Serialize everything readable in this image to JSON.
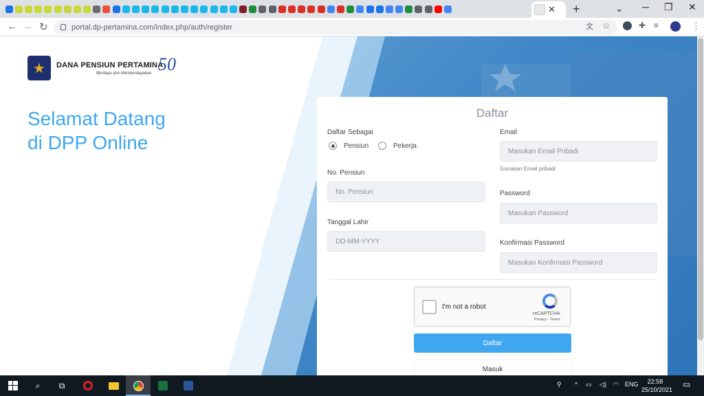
{
  "browser": {
    "url": "portal.dp-pertamina.com/index.php/auth/register",
    "tab_close": "✕",
    "new_tab": "+",
    "win_min": "─",
    "win_max": "❐",
    "win_close": "✕",
    "tab_icon_colors": [
      "#1a73e8",
      "#c8d93a",
      "#c8d93a",
      "#c8d93a",
      "#c8d93a",
      "#c8d93a",
      "#c8d93a",
      "#c8d93a",
      "#c8d93a",
      "#6b6b6b",
      "#e74c3c",
      "#1a73e8",
      "#1ab7ea",
      "#1ab7ea",
      "#1ab7ea",
      "#1ab7ea",
      "#1ab7ea",
      "#1ab7ea",
      "#1ab7ea",
      "#1ab7ea",
      "#1ab7ea",
      "#1ab7ea",
      "#1ab7ea",
      "#1ab7ea",
      "#7a1f2b",
      "#1e8e3e",
      "#5f6368",
      "#5f6368",
      "#d93025",
      "#d93025",
      "#d93025",
      "#d93025",
      "#d93025",
      "#4285f4",
      "#d93025",
      "#1e8e3e",
      "#4285f4",
      "#1a73e8",
      "#1a73e8",
      "#4285f4",
      "#4285f4",
      "#1e8e3e",
      "#5f6368",
      "#5f6368",
      "#ff0000",
      "#4285f4"
    ]
  },
  "page": {
    "logo_title": "DANA PENSIUN PERTAMINA",
    "logo_tagline": "Berdaya dan Memberdayakan",
    "logo_anniversary": "50",
    "headline_line1": "Selamat Datang",
    "headline_line2": "di DPP Online"
  },
  "form": {
    "title": "Daftar",
    "register_as_label": "Daftar Sebagai",
    "option_retiree": "Pensiun",
    "option_worker": "Pekerja",
    "selected_option": "Pensiun",
    "pension_no_label": "No. Pensiun",
    "pension_no_placeholder": "No. Pensiun",
    "dob_label": "Tanggal Lahir",
    "dob_placeholder": "DD-MM-YYYY",
    "email_label": "Email",
    "email_placeholder": "Masukan Email Pribadi",
    "email_help": "Gunakan Email pribadi",
    "password_label": "Password",
    "password_placeholder": "Masukan Password",
    "confirm_label": "Konfirmasi Password",
    "confirm_placeholder": "Masukan Konfirmasi Password",
    "captcha_label": "I'm not a robot",
    "captcha_brand": "reCAPTCHA",
    "captcha_links": "Privacy - Terms",
    "submit_label": "Daftar",
    "login_label": "Masuk"
  },
  "taskbar": {
    "language": "ENG",
    "time": "22:58",
    "date": "25/10/2021"
  },
  "colors": {
    "accent": "#3fa7f0",
    "taskbar": "#101820"
  }
}
